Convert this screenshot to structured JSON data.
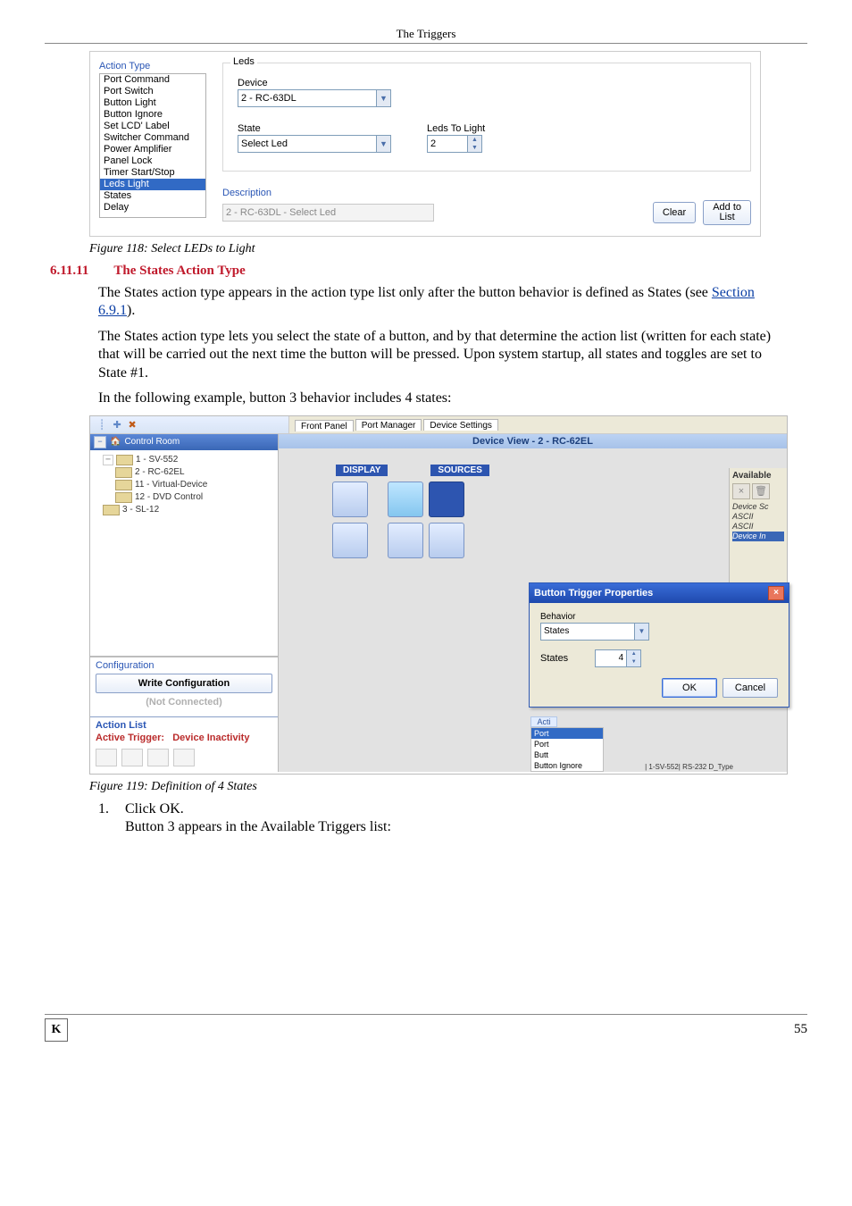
{
  "header": "The Triggers",
  "shot1": {
    "action_type_heading": "Action Type",
    "items": [
      "Port Command",
      "Port Switch",
      "Button Light",
      "Button Ignore",
      "Set LCD' Label",
      "Switcher Command",
      "Power Amplifier",
      "Panel Lock",
      "Timer Start/Stop",
      "Leds Light",
      "States",
      "Delay"
    ],
    "selected_index": 9,
    "leds_legend": "Leds",
    "device_label": "Device",
    "device_value": "2 - RC-63DL",
    "state_label": "State",
    "state_value": "Select Led",
    "leds_to_light_label": "Leds To Light",
    "leds_to_light_value": "2",
    "desc_label": "Description",
    "desc_value": "2 - RC-63DL - Select Led",
    "btn_clear": "Clear",
    "btn_add": "Add to\nList"
  },
  "fig118": "Figure 118: Select LEDs to Light",
  "section": {
    "num": "6.11.11",
    "title": "The States Action Type"
  },
  "para1_a": "The States action type appears in the action type list only after the button behavior is defined as States (see ",
  "para1_link": "Section 6.9.1",
  "para1_b": ").",
  "para2": "The States action type lets you select the state of a button, and by that determine the action list (written for each state) that will be carried out the next time the button will be pressed. Upon system startup, all states and toggles are set to State #1.",
  "para3": "In the following example, button 3 behavior includes 4 states:",
  "shot2": {
    "tabs": [
      "Front Panel",
      "Port Manager",
      "Device Settings"
    ],
    "tree_title": "Control Room",
    "tree": {
      "root": "1 - SV-552",
      "children": [
        "2 - RC-62EL",
        "11 - Virtual-Device",
        "12 - DVD Control",
        "3 - SL-12"
      ]
    },
    "config_label": "Configuration",
    "write_cfg": "Write Configuration",
    "not_connected": "(Not Connected)",
    "action_list_label": "Action List",
    "active_trigger_label": "Active Trigger:",
    "active_trigger_value": "Device Inactivity",
    "device_view_title": "Device View - 2 - RC-62EL",
    "panel_labels": [
      "DISPLAY",
      "SOURCES"
    ],
    "avail_title": "Available",
    "avail_list": [
      "Device Sc",
      "ASCII",
      "ASCII",
      "Device In"
    ],
    "dialog": {
      "title": "Button Trigger Properties",
      "behavior_label": "Behavior",
      "behavior_value": "States",
      "states_label": "States",
      "states_value": "4",
      "ok": "OK",
      "cancel": "Cancel"
    },
    "bottom_list_label_1": "Acti",
    "bottom_list_label_2": "Port",
    "bottom_list_label_3": "Port",
    "bottom_list_label_4": "Butt",
    "bottom_items": [
      "Button Ignore"
    ],
    "bottom_right": "| 1-SV-552| RS-232 D_Type"
  },
  "fig119": "Figure 119: Definition of 4 States",
  "step1_num": "1.",
  "step1_text": "Click OK.",
  "step1_sub": "Button 3 appears in the Available Triggers list:",
  "page_number": "55",
  "logo_text": "K"
}
